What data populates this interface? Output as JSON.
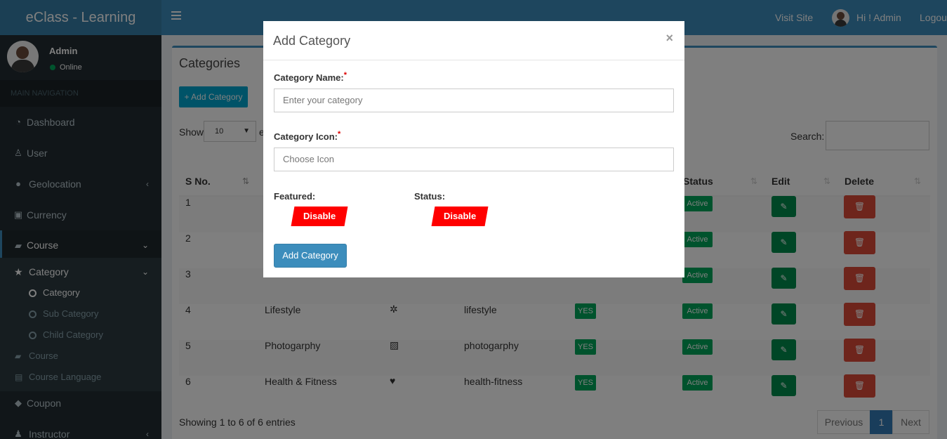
{
  "app": {
    "title": "eClass - Learning"
  },
  "header": {
    "visit_site": "Visit Site",
    "greeting": "Hi ! Admin",
    "logout": "Logout"
  },
  "sidebar": {
    "user_name": "Admin",
    "status": "Online",
    "nav_header": "MAIN NAVIGATION",
    "items": [
      {
        "label": "Dashboard",
        "icon": "dashboard-icon"
      },
      {
        "label": "User",
        "icon": "user-icon"
      },
      {
        "label": "Geolocation",
        "icon": "globe-icon"
      },
      {
        "label": "Currency",
        "icon": "money-icon"
      },
      {
        "label": "Course",
        "icon": "book-icon"
      },
      {
        "label": "Category",
        "icon": "star-icon"
      },
      {
        "label": "Course",
        "icon": "book-icon"
      },
      {
        "label": "Course Language",
        "icon": "language-icon"
      },
      {
        "label": "Coupon",
        "icon": "tag-icon"
      },
      {
        "label": "Instructor",
        "icon": "user-plus-icon"
      }
    ],
    "category_sub": [
      "Category",
      "Sub Category",
      "Child Category"
    ]
  },
  "main": {
    "title": "Categories",
    "add_button": "+ Add Category",
    "show_label": "Show",
    "page_length": "10",
    "entries_label": "e",
    "search_label": "Search:",
    "columns": [
      "S No.",
      "Status",
      "Edit",
      "Delete"
    ],
    "rows": [
      {
        "sno": "1",
        "name": "",
        "slug": "",
        "featured": "",
        "status": "Active"
      },
      {
        "sno": "2",
        "name": "",
        "slug": "",
        "featured": "",
        "status": "Active"
      },
      {
        "sno": "3",
        "name": "",
        "slug": "",
        "featured": "",
        "status": "Active"
      },
      {
        "sno": "4",
        "name": "Lifestyle",
        "slug": "lifestyle",
        "featured": "YES",
        "status": "Active"
      },
      {
        "sno": "5",
        "name": "Photogarphy",
        "slug": "photogarphy",
        "featured": "YES",
        "status": "Active"
      },
      {
        "sno": "6",
        "name": "Health & Fitness",
        "slug": "health-fitness",
        "featured": "YES",
        "status": "Active"
      }
    ],
    "showing": "Showing 1 to 6 of 6 entries",
    "pagination": {
      "previous": "Previous",
      "current": "1",
      "next": "Next"
    }
  },
  "modal": {
    "title": "Add Category",
    "close": "×",
    "name_label": "Category Name:",
    "name_placeholder": "Enter your category",
    "icon_label": "Category Icon:",
    "icon_placeholder": "Choose Icon",
    "featured_label": "Featured:",
    "featured_toggle": "Disable",
    "status_label": "Status:",
    "status_toggle": "Disable",
    "submit": "Add Category",
    "required_mark": "*"
  },
  "colors": {
    "brand": "#3c8dbc",
    "brand_dark": "#367fa9",
    "sidebar": "#222d32",
    "success": "#00a65a",
    "danger": "#dd4b39",
    "toggle_off": "#ff0000"
  }
}
